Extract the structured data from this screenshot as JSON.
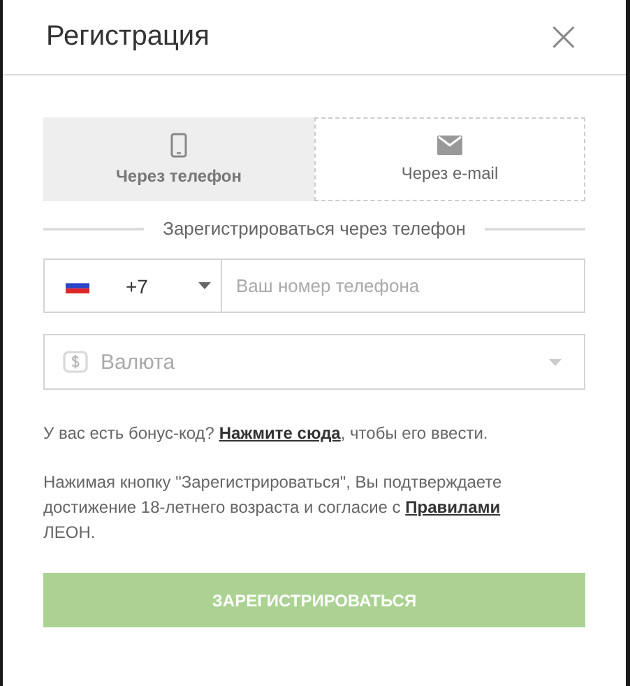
{
  "dialog": {
    "title": "Регистрация",
    "close": "×"
  },
  "tabs": [
    {
      "label": "Через телефон",
      "kind": "phone",
      "selected": true
    },
    {
      "label": "Через e-mail",
      "kind": "email",
      "selected": false
    }
  ],
  "separator": "Зарегистрироваться через телефон",
  "phone": {
    "code": "+7",
    "placeholder": "Ваш номер телефона"
  },
  "currency": {
    "placeholder": "Валюта"
  },
  "bonus": {
    "before": "У вас есть бонус-код? ",
    "link": "Нажмите сюда",
    "after": ", чтобы его ввести."
  },
  "terms": {
    "before": "Нажимая кнопку \"Зарегистрироваться\", Вы подтверждаете достижение 18-летнего возраста и согласие с ",
    "link": "Правилами",
    "after": " ЛЕОН."
  },
  "submit": {
    "label": "ЗАРЕГИСТРИРОВАТЬСЯ",
    "disabled": true
  }
}
